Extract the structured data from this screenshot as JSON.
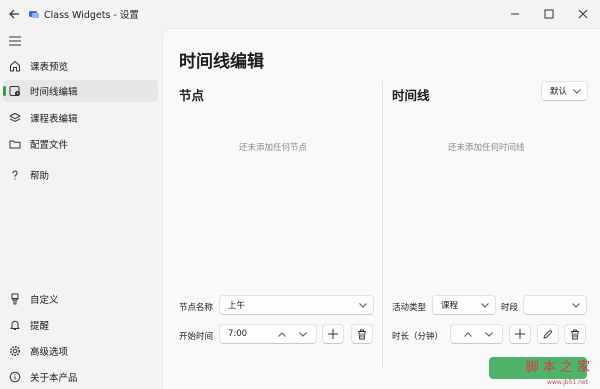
{
  "window": {
    "title": "Class Widgets - 设置"
  },
  "sidebar": {
    "items": [
      {
        "label": "课表预览",
        "icon": "home-icon"
      },
      {
        "label": "时间线编辑",
        "icon": "timeline-icon",
        "active": true
      },
      {
        "label": "课程表编辑",
        "icon": "stack-icon"
      },
      {
        "label": "配置文件",
        "icon": "folder-icon"
      },
      {
        "label": "帮助",
        "icon": "help-icon"
      }
    ],
    "bottom_items": [
      {
        "label": "自定义",
        "icon": "brush-icon"
      },
      {
        "label": "提醒",
        "icon": "bell-icon"
      },
      {
        "label": "高级选项",
        "icon": "gear-icon"
      },
      {
        "label": "关于本产品",
        "icon": "info-icon"
      }
    ]
  },
  "main": {
    "page_title": "时间线编辑",
    "nodes": {
      "title": "节点",
      "empty_hint": "还未添加任何节点",
      "node_name_label": "节点名称",
      "node_name_value": "上午",
      "start_time_label": "开始时间",
      "start_time_value": "7:00"
    },
    "timeline": {
      "title": "时间线",
      "preset_value": "默认",
      "empty_hint": "还未添加任何时间线",
      "activity_type_label": "活动类型",
      "activity_type_value": "课程",
      "period_label": "时段",
      "period_value": "",
      "duration_label": "时长（分钟）"
    }
  },
  "watermark": {
    "text": "脚 本 之 家",
    "url": "www.jb51.net"
  },
  "colors": {
    "accent": "#3a9a4a",
    "primary_button": "#4fb36a",
    "watermark": "#d8394c"
  }
}
